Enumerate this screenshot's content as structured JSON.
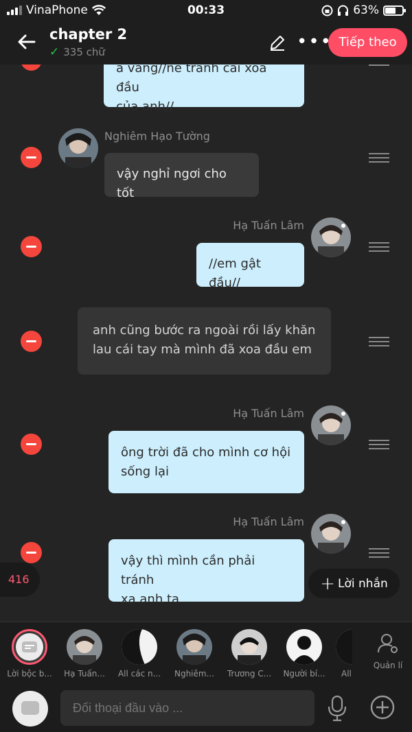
{
  "status": {
    "carrier": "VinaPhone",
    "time": "00:33",
    "battery": "63%"
  },
  "header": {
    "title": "chapter 2",
    "word_count": "335 chữ",
    "next_label": "Tiếp theo"
  },
  "messages": [
    {
      "speaker": "",
      "type": "me",
      "text_lines": [
        "a vàng//né tránh cái xoa đầu",
        "của anh//"
      ]
    },
    {
      "speaker": "Nghiêm Hạo Tường",
      "type": "other",
      "text": "vậy nghỉ ngơi cho tốt"
    },
    {
      "speaker": "Hạ Tuấn Lâm",
      "type": "me",
      "text": "//em gật đầu//"
    },
    {
      "speaker": "",
      "type": "narration",
      "text_lines": [
        "anh cũng bước ra ngoài rồi lấy khăn",
        "lau cái tay mà mình đã xoa đầu em"
      ]
    },
    {
      "speaker": "Hạ Tuấn Lâm",
      "type": "me",
      "text_lines": [
        "ông trời đã cho mình cơ hội",
        "sống lại"
      ]
    },
    {
      "speaker": "Hạ Tuấn Lâm",
      "type": "me",
      "text_lines": [
        "vậy thì mình cần phải tránh",
        "xa anh ta"
      ]
    }
  ],
  "message_count": "416",
  "add_message_label": "Lời nhắn",
  "characters": [
    {
      "label": "Lời bộc b..."
    },
    {
      "label": "Hạ Tuấn..."
    },
    {
      "label": "All các n..."
    },
    {
      "label": "Nghiêm..."
    },
    {
      "label": "Trương C..."
    },
    {
      "label": "Người bí..."
    },
    {
      "label": "All"
    }
  ],
  "manage_label": "Quản lí",
  "input": {
    "placeholder": "Đối thoại đầu vào ..."
  },
  "colors": {
    "accent": "#ff4d66",
    "bubble_me": "#cdeffd",
    "delete": "#f4463c"
  }
}
